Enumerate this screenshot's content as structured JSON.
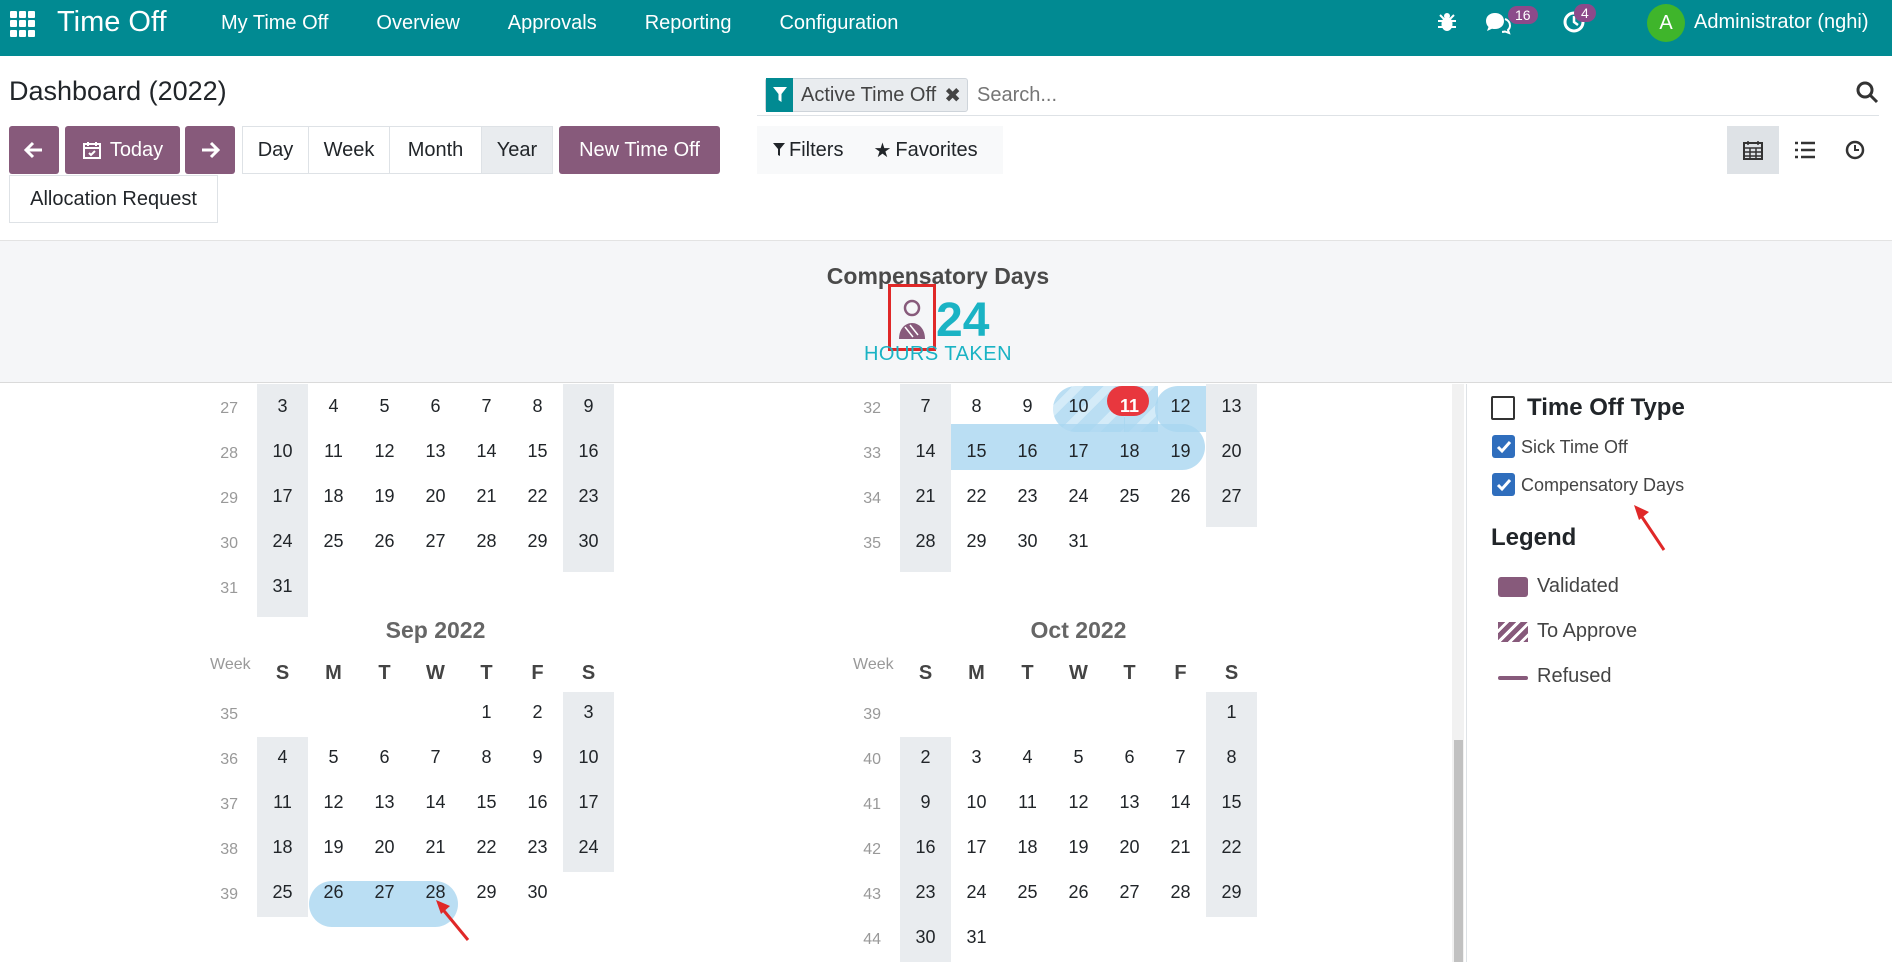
{
  "navbar": {
    "app_title": "Time Off",
    "menu": [
      "My Time Off",
      "Overview",
      "Approvals",
      "Reporting",
      "Configuration"
    ],
    "messages_count": "16",
    "activities_count": "4",
    "avatar_letter": "A",
    "user_name": "Administrator (nghi)",
    "brand_color": "#018a92"
  },
  "control": {
    "page_title": "Dashboard (2022)",
    "today_label": "Today",
    "scales": [
      "Day",
      "Week",
      "Month",
      "Year"
    ],
    "active_scale": "Year",
    "new_time_off_label": "New Time Off",
    "allocation_request_label": "Allocation Request",
    "facet_label": "Active Time Off",
    "search_placeholder": "Search...",
    "filters_label": "Filters",
    "favorites_label": "Favorites",
    "accent_color": "#875a7b"
  },
  "summary": {
    "title": "Compensatory Days",
    "value": "24",
    "label": "HOURS TAKEN"
  },
  "calendar": {
    "dow_labels": [
      "S",
      "M",
      "T",
      "W",
      "T",
      "F",
      "S"
    ],
    "week_header": "Week",
    "months": [
      {
        "key": "jul",
        "title": "",
        "week_numbers": [
          "27",
          "28",
          "29",
          "30",
          "31"
        ],
        "rows": [
          [
            "3",
            "4",
            "5",
            "6",
            "7",
            "8",
            "9"
          ],
          [
            "10",
            "11",
            "12",
            "13",
            "14",
            "15",
            "16"
          ],
          [
            "17",
            "18",
            "19",
            "20",
            "21",
            "22",
            "23"
          ],
          [
            "24",
            "25",
            "26",
            "27",
            "28",
            "29",
            "30"
          ],
          [
            "31",
            "",
            "",
            "",
            "",
            "",
            ""
          ]
        ]
      },
      {
        "key": "aug",
        "title": "",
        "week_numbers": [
          "32",
          "33",
          "34",
          "35"
        ],
        "rows": [
          [
            "7",
            "8",
            "9",
            "10",
            "11",
            "12",
            "13"
          ],
          [
            "14",
            "15",
            "16",
            "17",
            "18",
            "19",
            "20"
          ],
          [
            "21",
            "22",
            "23",
            "24",
            "25",
            "26",
            "27"
          ],
          [
            "28",
            "29",
            "30",
            "31",
            "",
            "",
            ""
          ]
        ]
      },
      {
        "key": "sep",
        "title": "Sep 2022",
        "week_numbers": [
          "35",
          "36",
          "37",
          "38",
          "39"
        ],
        "rows": [
          [
            "",
            "",
            "",
            "",
            "1",
            "2",
            "3"
          ],
          [
            "4",
            "5",
            "6",
            "7",
            "8",
            "9",
            "10"
          ],
          [
            "11",
            "12",
            "13",
            "14",
            "15",
            "16",
            "17"
          ],
          [
            "18",
            "19",
            "20",
            "21",
            "22",
            "23",
            "24"
          ],
          [
            "25",
            "26",
            "27",
            "28",
            "29",
            "30",
            ""
          ]
        ]
      },
      {
        "key": "oct",
        "title": "Oct 2022",
        "week_numbers": [
          "39",
          "40",
          "41",
          "42",
          "43",
          "44"
        ],
        "rows": [
          [
            "",
            "",
            "",
            "",
            "",
            "",
            "1"
          ],
          [
            "2",
            "3",
            "4",
            "5",
            "6",
            "7",
            "8"
          ],
          [
            "9",
            "10",
            "11",
            "12",
            "13",
            "14",
            "15"
          ],
          [
            "16",
            "17",
            "18",
            "19",
            "20",
            "21",
            "22"
          ],
          [
            "23",
            "24",
            "25",
            "26",
            "27",
            "28",
            "29"
          ],
          [
            "30",
            "31",
            "",
            "",
            "",
            "",
            ""
          ]
        ]
      }
    ],
    "today_day": "11",
    "highlight_color": "#a9d6f0",
    "today_color": "#e8373e"
  },
  "side_panel": {
    "time_off_type_heading": "Time Off Type",
    "types": [
      "Sick Time Off",
      "Compensatory Days"
    ],
    "legend_heading": "Legend",
    "legend": [
      "Validated",
      "To Approve",
      "Refused"
    ],
    "legend_color": "#875a7b"
  }
}
